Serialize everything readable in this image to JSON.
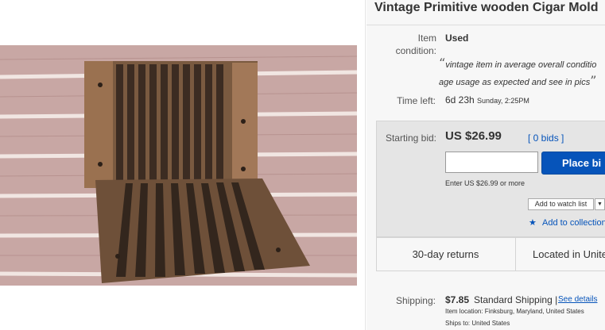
{
  "item": {
    "title": "Vintage Primitive wooden Cigar Mold",
    "image_alt": "wooden cigar mold photo"
  },
  "condition": {
    "label_line1": "Item",
    "label_line2": "condition:",
    "value": "Used",
    "quote_open": "“",
    "quote_line1": "vintage item in average overall conditio",
    "quote_line2": "age usage as expected and see in pics",
    "quote_close": "”"
  },
  "time_left": {
    "label": "Time left:",
    "value": "6d 23h",
    "end": "Sunday, 2:25PM"
  },
  "bidding": {
    "label": "Starting bid:",
    "price": "US $26.99",
    "bids_link": "[ 0 bids ]",
    "input_value": "",
    "place_bid_label": "Place bi",
    "enter_hint": "Enter US $26.99 or more",
    "watch_label": "Add to watch list",
    "watch_caret": "▼",
    "collection_label": "Add to collection",
    "accent_color": "#0654ba"
  },
  "info_bar": {
    "returns": "30-day returns",
    "located": "Located in Unite"
  },
  "shipping": {
    "label": "Shipping:",
    "price": "$7.85",
    "method": "Standard Shipping |",
    "see_details": "See details",
    "item_location": "Item location:  Finksburg, Maryland, United States",
    "ships_to": "Ships to:  United States"
  }
}
